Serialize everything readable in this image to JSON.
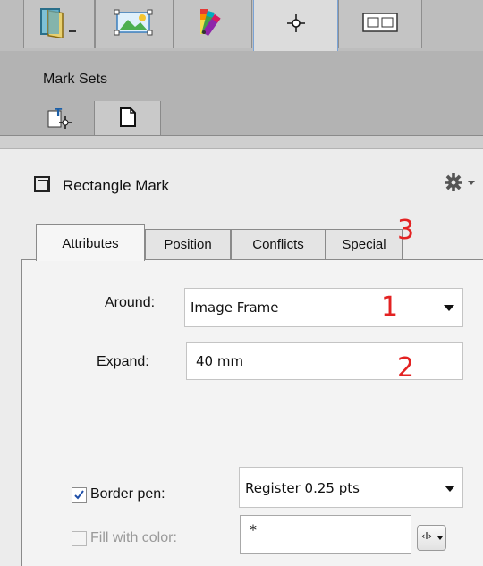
{
  "toolbar": {
    "tabs": [
      {
        "icon": "document-dropdown-icon"
      },
      {
        "icon": "image-frame-icon"
      },
      {
        "icon": "color-swatches-icon"
      },
      {
        "icon": "crosshair-mark-icon"
      },
      {
        "icon": "layout-icon"
      }
    ]
  },
  "mark_sets": {
    "title": "Mark Sets",
    "buttons": [
      {
        "icon": "text-mark-icon"
      },
      {
        "icon": "page-icon"
      }
    ]
  },
  "mark": {
    "title": "Rectangle Mark",
    "menu_icon": "gear-dropdown-icon"
  },
  "tabs": [
    "Attributes",
    "Position",
    "Conflicts",
    "Special"
  ],
  "form": {
    "around_label": "Around:",
    "around_value": "Image Frame",
    "expand_label": "Expand:",
    "expand_value": "40 mm",
    "border_pen_label": "Border pen:",
    "border_pen_checked": true,
    "border_pen_value": "Register 0.25 pts",
    "fill_label": "Fill with color:",
    "fill_checked": false,
    "fill_value": "*"
  },
  "annotations": [
    "1",
    "2",
    "3"
  ],
  "colors": {
    "annotation": "#e32222",
    "active_tab_border": "#7aa3d6"
  }
}
